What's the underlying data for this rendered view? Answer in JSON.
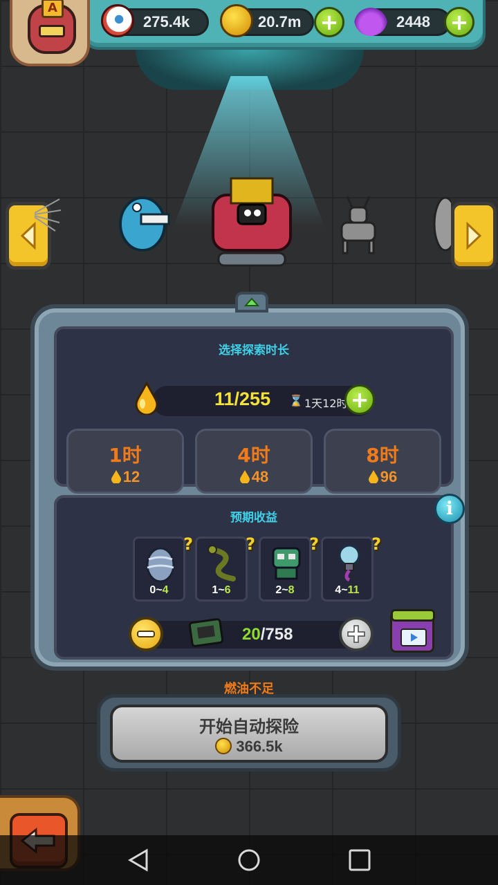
{
  "top_bar": {
    "rank_letter": "A",
    "resources": [
      {
        "icon": "eyeball-icon",
        "value": "275.4k"
      },
      {
        "icon": "gold-coin-icon",
        "value": "20.7m"
      },
      {
        "icon": "purple-potion-icon",
        "value": "2448"
      }
    ],
    "plus_label": "+"
  },
  "exploration": {
    "title": "选择探索时长",
    "fuel": {
      "value": "11/255",
      "timer": "1天12时",
      "hourglass": "⌛"
    },
    "durations": [
      {
        "label": "1时",
        "cost": "12"
      },
      {
        "label": "4时",
        "cost": "48"
      },
      {
        "label": "8时",
        "cost": "96"
      }
    ]
  },
  "rewards": {
    "title": "预期收益",
    "info_label": "i",
    "items": [
      {
        "icon": "striped-egg-icon",
        "low": "0",
        "sep": "~",
        "high": "4"
      },
      {
        "icon": "green-serpent-icon",
        "low": "1",
        "sep": "~",
        "high": "6"
      },
      {
        "icon": "green-robot-icon",
        "low": "2",
        "sep": "~",
        "high": "8"
      },
      {
        "icon": "lightbulb-creature-icon",
        "low": "4",
        "sep": "~",
        "high": "11"
      }
    ],
    "question_mark": "?",
    "quantity": {
      "current": "20",
      "total": "/758"
    }
  },
  "start": {
    "warning": "燃油不足",
    "label": "开始自动探险",
    "cost": "366.5k"
  },
  "colors": {
    "accent_cyan": "#3fd0e6",
    "fuel_yellow": "#f4e23a",
    "cost_orange": "#f07b1a",
    "plus_green": "#8fdc2c"
  }
}
